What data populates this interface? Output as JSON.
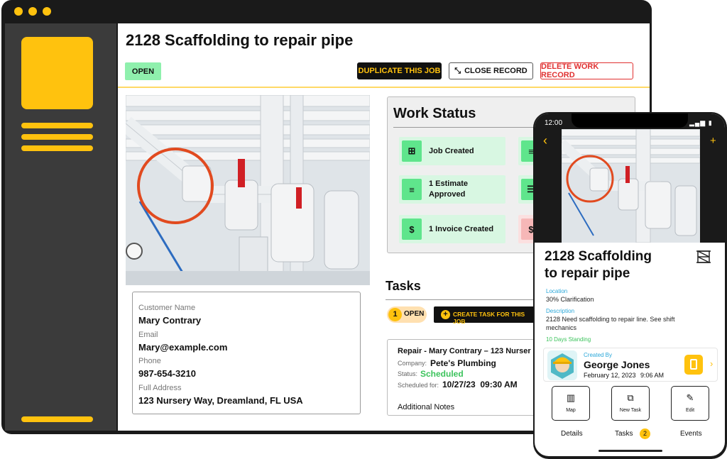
{
  "page": {
    "title": "2128 Scaffolding to repair pipe",
    "status_badge": "OPEN",
    "buttons": {
      "duplicate": "DUPLICATE THIS JOB",
      "close": "CLOSE RECORD",
      "delete": "DELETE WORK RECORD"
    }
  },
  "customer": {
    "name_label": "Customer Name",
    "name": "Mary Contrary",
    "email_label": "Email",
    "email": "Mary@example.com",
    "phone_label": "Phone",
    "phone": "987-654-3210",
    "address_label": "Full Address",
    "address": "123 Nursery Way, Dreamland, FL USA"
  },
  "work_status": {
    "title": "Work Status",
    "items": [
      {
        "icon": "hierarchy-icon",
        "label": "Job Created"
      },
      {
        "icon": "document-icon",
        "label_line1": "1 Estimate",
        "label_line2": "Approved"
      },
      {
        "icon": "dollar-document-icon",
        "label": "1 Invoice Created"
      }
    ]
  },
  "tasks": {
    "title": "Tasks",
    "open_count": "1",
    "open_label": "OPEN",
    "create_button": "CREATE TASK FOR THIS JOB",
    "task": {
      "title": "Repair - Mary Contrary – 123 Nurser",
      "company_label": "Company:",
      "company": "Pete's Plumbing",
      "status_label": "Status:",
      "status": "Scheduled",
      "scheduled_label": "Scheduled for:",
      "scheduled": "10/27/23  09:30 AM",
      "notes_label": "Additional Notes"
    }
  },
  "phone": {
    "time": "12:00",
    "back_icon": "chevron-left-icon",
    "add_icon": "plus-icon",
    "title_line1": "2128 Scaffolding",
    "title_line2": "to repair pipe",
    "location_label": "Location",
    "location": "30% Clarification",
    "description_label": "Description",
    "description_line1": "2128 Need scaffolding to repair line. See shift",
    "description_line2": "mechanics",
    "standing": "10 Days Standing",
    "created_by_label": "Created By",
    "created_by_name": "George Jones",
    "created_date": "February 12, 2023",
    "created_time": "9:06 AM",
    "actions": {
      "map": "Map",
      "new_task": "New Task",
      "edit": "Edit"
    },
    "tabs": {
      "details": "Details",
      "tasks": "Tasks",
      "tasks_badge": "2",
      "events": "Events"
    }
  },
  "colors": {
    "accent": "#ffc20e",
    "open_green": "#8ff0ad",
    "status_green": "#3cc35c",
    "delete_red": "#e03030",
    "link_blue": "#2aa7d9",
    "frame_dark": "#1a1a1a",
    "sidebar_gray": "#3b3b3b"
  }
}
